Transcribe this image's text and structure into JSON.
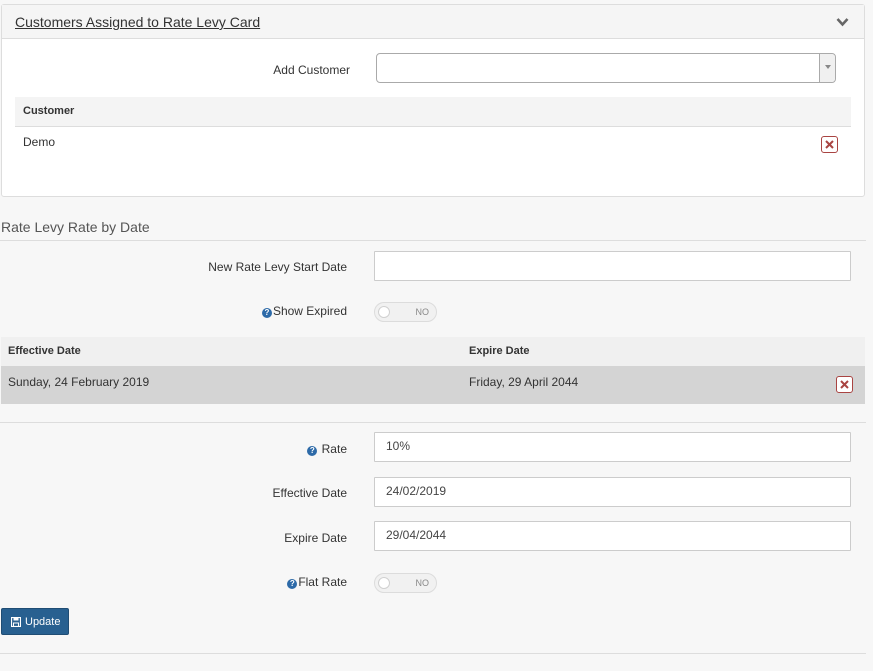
{
  "customers_panel": {
    "title": "Customers Assigned to Rate Levy Card",
    "add_customer_label": "Add Customer",
    "add_customer_value": "",
    "table": {
      "column_header": "Customer",
      "rows": [
        {
          "customer": "Demo"
        }
      ]
    }
  },
  "rate_by_date": {
    "title": "Rate Levy Rate by Date",
    "new_start_date_label": "New Rate Levy Start Date",
    "new_start_date_value": "",
    "show_expired_label": "Show Expired",
    "show_expired_state": "NO",
    "table": {
      "headers": {
        "effective": "Effective Date",
        "expire": "Expire Date"
      },
      "rows": [
        {
          "effective": "Sunday, 24 February 2019",
          "expire": "Friday, 29 April 2044"
        }
      ]
    }
  },
  "edit_form": {
    "rate_label": "Rate",
    "rate_value": "10%",
    "effective_label": "Effective Date",
    "effective_value": "24/02/2019",
    "expire_label": "Expire Date",
    "expire_value": "29/04/2044",
    "flat_rate_label": "Flat Rate",
    "flat_rate_state": "NO",
    "update_label": "Update"
  },
  "icons": {
    "collapse": "chevron-down-icon",
    "delete": "delete-x-icon",
    "help": "question-circle-icon",
    "save": "floppy-disk-icon"
  },
  "colors": {
    "primary": "#286090",
    "danger": "#a94442",
    "selected_row": "#d4d4d4"
  }
}
